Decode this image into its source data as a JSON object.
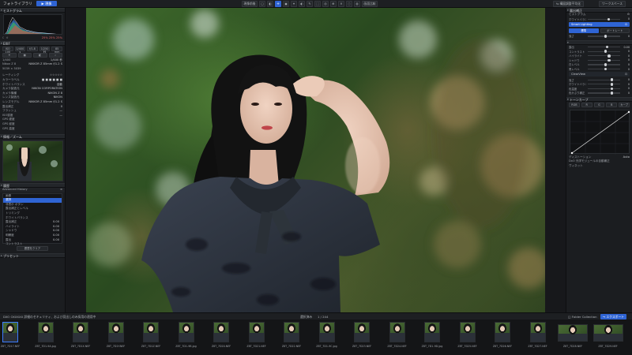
{
  "topbar": {
    "app_title": "フォトライブラリ",
    "mode_button": "▶ 現像",
    "tools": [
      "現像前後",
      "▢",
      "◧",
      "✛",
      "▣",
      "⌖",
      "◐",
      "✎",
      "⬚",
      "◎",
      "⊕",
      "✕",
      "◌",
      "◍",
      "画面比較"
    ],
    "right_left_btn": "⇆ 構図調整平均化",
    "right_right_btn": "ワークスペース"
  },
  "left": {
    "histogram_title": "ヒストグラム",
    "histogram_values": "25% 25% 25%",
    "exif_head": "EXIF",
    "exif_btns": [
      "ISO 100",
      "1/400 s",
      "f/1.8",
      "1/250秒",
      "85 mm"
    ],
    "info_rows": [
      {
        "k": "1/400",
        "v": "1/400 秒"
      },
      {
        "k": "Nikon Z 8",
        "v": "NIKKOR Z 85mm f/1.2 S"
      },
      {
        "k": "5039 × 5039",
        "v": ""
      }
    ],
    "meta_rows": [
      {
        "k": "レーティング",
        "v": "☆☆☆☆☆"
      },
      {
        "k": "カラーラベル",
        "v": "■ ■ ■ ■ ■ ■"
      },
      {
        "k": "ホワイトバランス",
        "v": "自動"
      },
      {
        "k": "カメラ製造元",
        "v": "NIKON CORPORATION"
      },
      {
        "k": "カメラ機種",
        "v": "NIKON Z 8"
      },
      {
        "k": "レンズ製造元",
        "v": "NIKON"
      },
      {
        "k": "レンズモデル",
        "v": "NIKKOR Z 85mm f/1.2 S"
      },
      {
        "k": "露出補正",
        "v": "0"
      },
      {
        "k": "フラッシュ",
        "v": "—"
      },
      {
        "k": "ISO感度",
        "v": "—"
      },
      {
        "k": "GPS 緯度",
        "v": ""
      },
      {
        "k": "GPS 経度",
        "v": ""
      },
      {
        "k": "GPS 高度",
        "v": ""
      }
    ],
    "navigator_title": "情報／ズーム",
    "history_section": "履歴",
    "history_head": "Advanced History",
    "history_items": [
      "画像",
      "選択",
      "非表示 ボタン",
      "露出補正とレベル",
      "トリミング",
      "ホワイトバランス",
      "露出補正",
      "ハイライト",
      "シャドウ",
      "明瞭度",
      "露出",
      "コントラスト"
    ],
    "history_values": [
      "",
      "",
      "",
      "",
      "",
      "",
      "0.00",
      "0.00",
      "0.00",
      "0.00",
      "0.00",
      ""
    ],
    "clear_history": "履歴をクリア",
    "presets_head": "プリセット"
  },
  "right": {
    "section1": "露出補正",
    "tone_head": "ヒストグラム",
    "wb_head": "ホワイトバランス",
    "blue_bar1_l": "Smart Lighting",
    "blue_bar1_r": "",
    "mode_btns": [
      "標準",
      "ポートレート"
    ],
    "sliders1": [
      {
        "l": "強さ",
        "v": "0",
        "p": 0.5
      }
    ],
    "sliders2": [
      {
        "l": "露出",
        "v": "0.00",
        "p": 0.55
      },
      {
        "l": "コントラスト",
        "v": "0",
        "p": 0.5
      },
      {
        "l": "ハイライト",
        "v": "0",
        "p": 0.62
      },
      {
        "l": "シャドウ",
        "v": "0",
        "p": 0.62
      },
      {
        "l": "白レベル",
        "v": "0",
        "p": 0.5
      },
      {
        "l": "黒レベル",
        "v": "0",
        "p": 0.5
      }
    ],
    "blue_bar2_l": "ClearView",
    "sliders3": [
      {
        "l": "強さ",
        "v": "0",
        "p": 0.7
      },
      {
        "l": "ホワイトバランス",
        "v": "0",
        "p": 0.7
      },
      {
        "l": "色温度",
        "v": "0",
        "p": 0.7
      },
      {
        "l": "色かぶり補正",
        "v": "0",
        "p": 0.7
      }
    ],
    "curve_head": "トーンカーブ",
    "curve_labels": [
      "RGB",
      "R",
      "G",
      "B"
    ],
    "curve_mode": "カーブ",
    "footer_rows": [
      {
        "k": "ディストーション",
        "v": "Auto"
      },
      {
        "k": "DxO 光学モジュールの自動補正",
        "v": ""
      },
      {
        "k": "ヴィネット",
        "v": ""
      }
    ]
  },
  "film": {
    "left_label": "DXO OXXXXX 詳細のセキュリティ、および見出しのみ採用の適用中",
    "count_label": "選択済み",
    "count_value": "1 / 244",
    "btn_collection": "◫ Folder Collection",
    "btn_export": "↪ エクスポート",
    "frames": [
      {
        "n": "Z8T_7D17.NEF"
      },
      {
        "n": "Z8T_7D1-9A.jpg"
      },
      {
        "n": "Z8T_7D1X.NEF"
      },
      {
        "n": "Z8T_7D1Y.NEF"
      },
      {
        "n": "Z8T_7D1Z.NEF"
      },
      {
        "n": "Z8T_7D1-9B.jpg"
      },
      {
        "n": "Z8T_7D20.NEF"
      },
      {
        "n": "Z8T_7D21.NEF"
      },
      {
        "n": "Z8T_7D22.NEF"
      },
      {
        "n": "Z8T_7D1-9C.jpg"
      },
      {
        "n": "Z8T_7D23.NEF"
      },
      {
        "n": "Z8T_7D24.NEF"
      },
      {
        "n": "Z8T_7D1-9D.jpg"
      },
      {
        "n": "Z8T_7D25.NEF"
      },
      {
        "n": "Z8T_7D26.NEF"
      },
      {
        "n": "Z8T_7D27.NEF"
      },
      {
        "n": "Z8T_7D28.NEF"
      },
      {
        "n": "Z8T_7D29.NEF"
      },
      {
        "n": "Z8T_7D30.NEF"
      }
    ]
  },
  "colors": {
    "accent": "#2f64d4",
    "panel": "#1b1d20",
    "bg": "#141517"
  }
}
